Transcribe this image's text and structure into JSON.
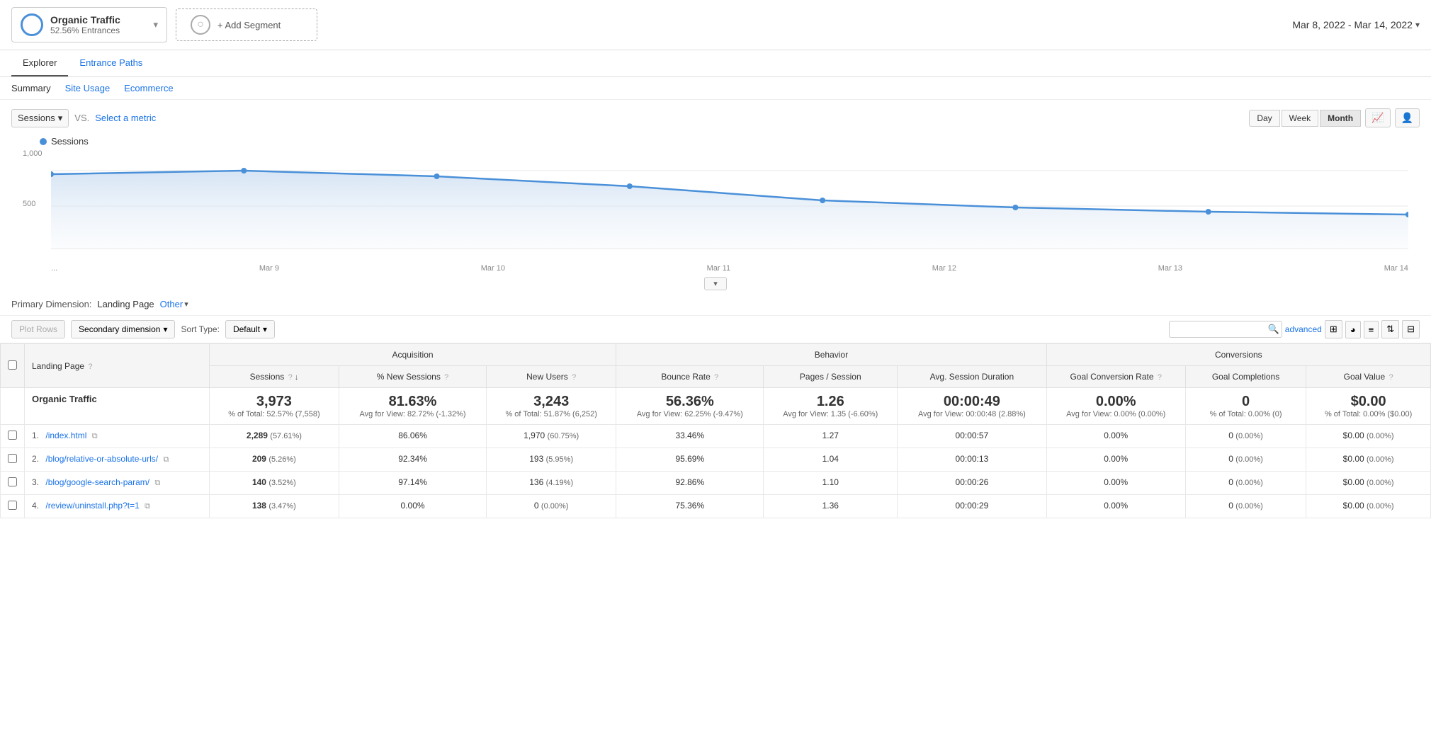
{
  "header": {
    "segment_name": "Organic Traffic",
    "segment_sub": "52.56% Entrances",
    "add_segment_label": "+ Add Segment",
    "date_range": "Mar 8, 2022 - Mar 14, 2022"
  },
  "tabs": {
    "explorer": "Explorer",
    "entrance_paths": "Entrance Paths"
  },
  "sub_tabs": {
    "summary": "Summary",
    "site_usage": "Site Usage",
    "ecommerce": "Ecommerce"
  },
  "chart": {
    "metric_label": "Sessions",
    "vs_label": "VS.",
    "select_metric": "Select a metric",
    "y_labels": [
      "1,000",
      "500",
      ""
    ],
    "x_labels": [
      "...",
      "Mar 9",
      "Mar 10",
      "Mar 11",
      "Mar 12",
      "Mar 13",
      "Mar 14"
    ],
    "time_buttons": [
      "Day",
      "Week",
      "Month"
    ],
    "active_time": "Month",
    "legend": "Sessions"
  },
  "primary_dimension": {
    "label": "Primary Dimension:",
    "landing_page": "Landing Page",
    "other": "Other"
  },
  "toolbar": {
    "plot_rows": "Plot Rows",
    "secondary_dimension": "Secondary dimension",
    "sort_type_label": "Sort Type:",
    "sort_default": "Default",
    "advanced": "advanced",
    "search_placeholder": ""
  },
  "table": {
    "headers": {
      "landing_page": "Landing Page",
      "acquisition": "Acquisition",
      "behavior": "Behavior",
      "conversions": "Conversions"
    },
    "col_headers": [
      {
        "label": "Sessions",
        "sortable": true,
        "help": true
      },
      {
        "label": "% New Sessions",
        "help": true
      },
      {
        "label": "New Users",
        "help": true
      },
      {
        "label": "Bounce Rate",
        "help": true
      },
      {
        "label": "Pages / Session",
        "help": false
      },
      {
        "label": "Avg. Session Duration",
        "help": false
      },
      {
        "label": "Goal Conversion Rate",
        "help": true
      },
      {
        "label": "Goal Completions",
        "help": false
      },
      {
        "label": "Goal Value",
        "help": true
      }
    ],
    "total": {
      "label": "Organic Traffic",
      "sessions": "3,973",
      "sessions_sub": "% of Total: 52.57% (7,558)",
      "new_sessions": "81.63%",
      "new_sessions_sub": "Avg for View: 82.72% (-1.32%)",
      "new_users": "3,243",
      "new_users_sub": "% of Total: 51.87% (6,252)",
      "bounce_rate": "56.36%",
      "bounce_rate_sub": "Avg for View: 62.25% (-9.47%)",
      "pages_session": "1.26",
      "pages_session_sub": "Avg for View: 1.35 (-6.60%)",
      "avg_session": "00:00:49",
      "avg_session_sub": "Avg for View: 00:00:48 (2.88%)",
      "goal_conv": "0.00%",
      "goal_conv_sub": "Avg for View: 0.00% (0.00%)",
      "goal_comp": "0",
      "goal_comp_sub": "% of Total: 0.00% (0)",
      "goal_value": "$0.00",
      "goal_value_sub": "% of Total: 0.00% ($0.00)"
    },
    "rows": [
      {
        "num": "1.",
        "page": "/index.html",
        "sessions": "2,289",
        "sessions_pct": "(57.61%)",
        "new_sessions": "86.06%",
        "new_users": "1,970",
        "new_users_pct": "(60.75%)",
        "bounce_rate": "33.46%",
        "pages_session": "1.27",
        "avg_session": "00:00:57",
        "goal_conv": "0.00%",
        "goal_comp": "0",
        "goal_comp_pct": "(0.00%)",
        "goal_value": "$0.00",
        "goal_value_pct": "(0.00%)"
      },
      {
        "num": "2.",
        "page": "/blog/relative-or-absolute-urls/",
        "sessions": "209",
        "sessions_pct": "(5.26%)",
        "new_sessions": "92.34%",
        "new_users": "193",
        "new_users_pct": "(5.95%)",
        "bounce_rate": "95.69%",
        "pages_session": "1.04",
        "avg_session": "00:00:13",
        "goal_conv": "0.00%",
        "goal_comp": "0",
        "goal_comp_pct": "(0.00%)",
        "goal_value": "$0.00",
        "goal_value_pct": "(0.00%)"
      },
      {
        "num": "3.",
        "page": "/blog/google-search-param/",
        "sessions": "140",
        "sessions_pct": "(3.52%)",
        "new_sessions": "97.14%",
        "new_users": "136",
        "new_users_pct": "(4.19%)",
        "bounce_rate": "92.86%",
        "pages_session": "1.10",
        "avg_session": "00:00:26",
        "goal_conv": "0.00%",
        "goal_comp": "0",
        "goal_comp_pct": "(0.00%)",
        "goal_value": "$0.00",
        "goal_value_pct": "(0.00%)"
      },
      {
        "num": "4.",
        "page": "/review/uninstall.php?t=1",
        "sessions": "138",
        "sessions_pct": "(3.47%)",
        "new_sessions": "0.00%",
        "new_users": "0",
        "new_users_pct": "(0.00%)",
        "bounce_rate": "75.36%",
        "pages_session": "1.36",
        "avg_session": "00:00:29",
        "goal_conv": "0.00%",
        "goal_comp": "0",
        "goal_comp_pct": "(0.00%)",
        "goal_value": "$0.00",
        "goal_value_pct": "(0.00%)"
      }
    ]
  }
}
